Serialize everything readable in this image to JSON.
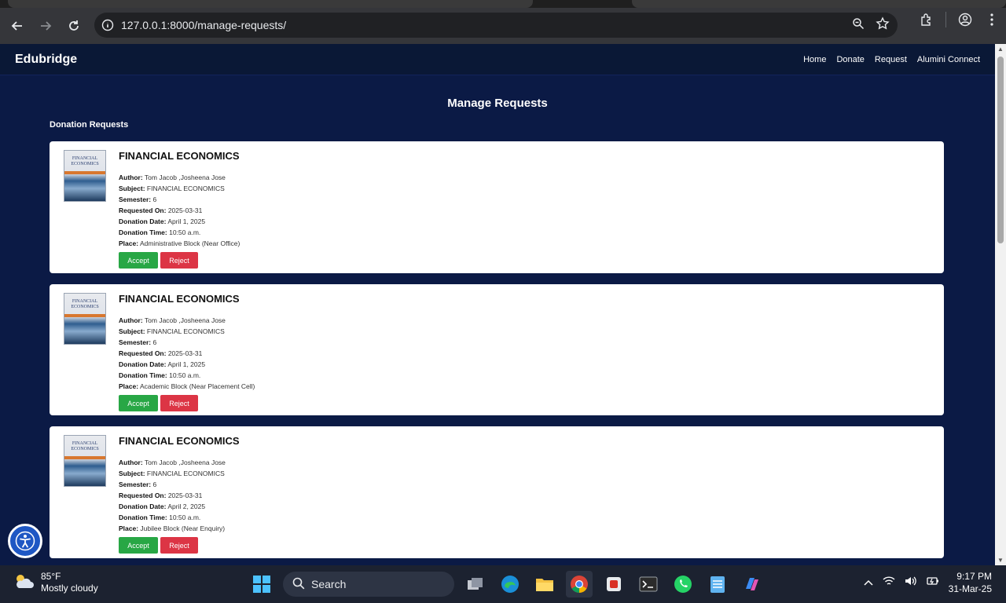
{
  "browser": {
    "url": "127.0.0.1:8000/manage-requests/"
  },
  "navbar": {
    "brand": "Edubridge",
    "links": [
      "Home",
      "Donate",
      "Request",
      "Alumini Connect"
    ]
  },
  "page_title": "Manage Requests",
  "section_title": "Donation Requests",
  "labels": {
    "author": "Author:",
    "subject": "Subject:",
    "semester": "Semester:",
    "requested_on": "Requested On:",
    "donation_date": "Donation Date:",
    "donation_time": "Donation Time:",
    "place": "Place:",
    "accept": "Accept",
    "reject": "Reject",
    "cover_text": "FINANCIAL ECONOMICS"
  },
  "requests": [
    {
      "title": "FINANCIAL ECONOMICS",
      "author": "Tom Jacob ,Josheena Jose",
      "subject": "FINANCIAL ECONOMICS",
      "semester": "6",
      "requested_on": "2025-03-31",
      "donation_date": "April 1, 2025",
      "donation_time": "10:50 a.m.",
      "place": "Administrative Block (Near Office)"
    },
    {
      "title": "FINANCIAL ECONOMICS",
      "author": "Tom Jacob ,Josheena Jose",
      "subject": "FINANCIAL ECONOMICS",
      "semester": "6",
      "requested_on": "2025-03-31",
      "donation_date": "April 1, 2025",
      "donation_time": "10:50 a.m.",
      "place": "Academic Block (Near Placement Cell)"
    },
    {
      "title": "FINANCIAL ECONOMICS",
      "author": "Tom Jacob ,Josheena Jose",
      "subject": "FINANCIAL ECONOMICS",
      "semester": "6",
      "requested_on": "2025-03-31",
      "donation_date": "April 2, 2025",
      "donation_time": "10:50 a.m.",
      "place": "Jubilee Block (Near Enquiry)"
    }
  ],
  "taskbar": {
    "weather_temp": "85°F",
    "weather_desc": "Mostly cloudy",
    "search_label": "Search",
    "time": "9:17 PM",
    "date": "31-Mar-25"
  }
}
